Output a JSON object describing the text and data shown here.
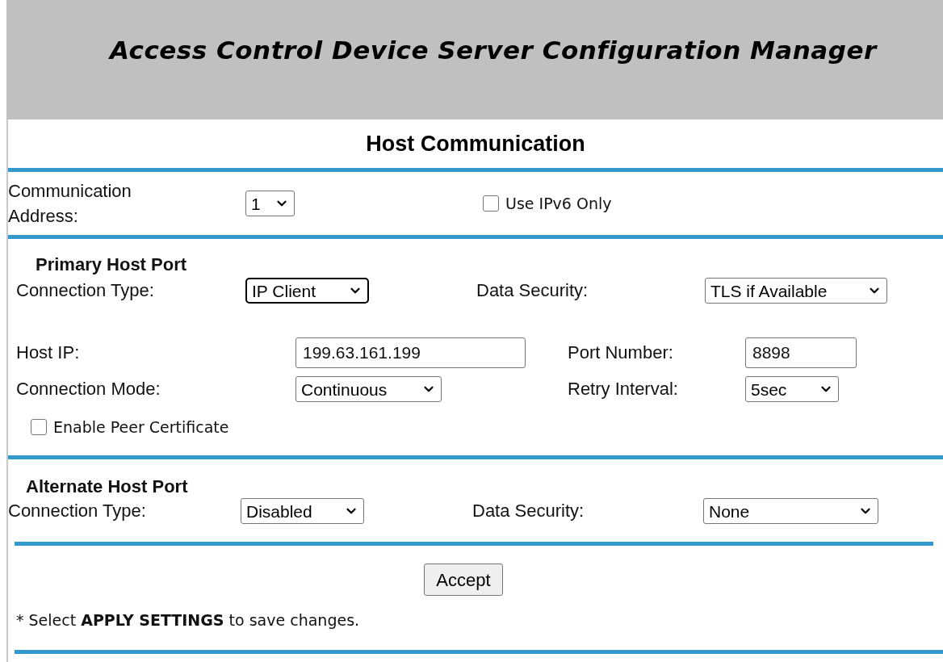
{
  "header": {
    "title": "Access Control Device Server Configuration Manager"
  },
  "section_title": "Host Communication",
  "communication_address": {
    "label": "Communication Address:",
    "value": "1",
    "focused": false
  },
  "ipv6_only": {
    "label": "Use IPv6 Only",
    "checked": false
  },
  "primary_host_port": {
    "heading": "Primary Host Port",
    "connection_type": {
      "label": "Connection Type:",
      "value": "IP Client",
      "focused": true
    },
    "data_security": {
      "label": "Data Security:",
      "value": "TLS if Available",
      "focused": false
    },
    "host_ip": {
      "label": "Host IP:",
      "value": "199.63.161.199"
    },
    "port_number": {
      "label": "Port Number:",
      "value": "8898"
    },
    "connection_mode": {
      "label": "Connection Mode:",
      "value": "Continuous",
      "focused": false
    },
    "retry_interval": {
      "label": "Retry Interval:",
      "value": "5sec",
      "focused": false
    },
    "peer_certificate": {
      "label": "Enable Peer Certificate",
      "checked": false
    }
  },
  "alternate_host_port": {
    "heading": "Alternate Host Port",
    "connection_type": {
      "label": "Connection Type:",
      "value": "Disabled",
      "focused": false
    },
    "data_security": {
      "label": "Data Security:",
      "value": "None",
      "focused": false
    }
  },
  "accept_button": "Accept",
  "footnote": "* Select **APPLY SETTINGS** to save changes."
}
